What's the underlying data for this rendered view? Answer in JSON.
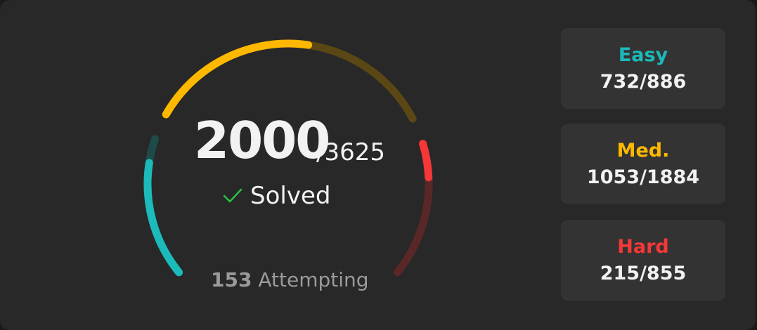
{
  "progress": {
    "solved": "2000",
    "total_label": "/3625",
    "solved_label": "Solved",
    "attempting_count": "153",
    "attempting_label": "Attempting"
  },
  "gauge": {
    "total": 3625,
    "segments": [
      {
        "key": "easy",
        "solved": 732,
        "total": 886,
        "color": "#1cbaba",
        "track": "#1f4a4a"
      },
      {
        "key": "medium",
        "solved": 1053,
        "total": 1884,
        "color": "#ffb800",
        "track": "#5a4714"
      },
      {
        "key": "hard",
        "solved": 215,
        "total": 855,
        "color": "#f63737",
        "track": "#5a2727"
      }
    ]
  },
  "difficulties": [
    {
      "label": "Easy",
      "value": "732/886",
      "color": "#1cbaba"
    },
    {
      "label": "Med.",
      "value": "1053/1884",
      "color": "#ffb800"
    },
    {
      "label": "Hard",
      "value": "215/855",
      "color": "#f63737"
    }
  ],
  "icons": {
    "check": "check-icon"
  }
}
